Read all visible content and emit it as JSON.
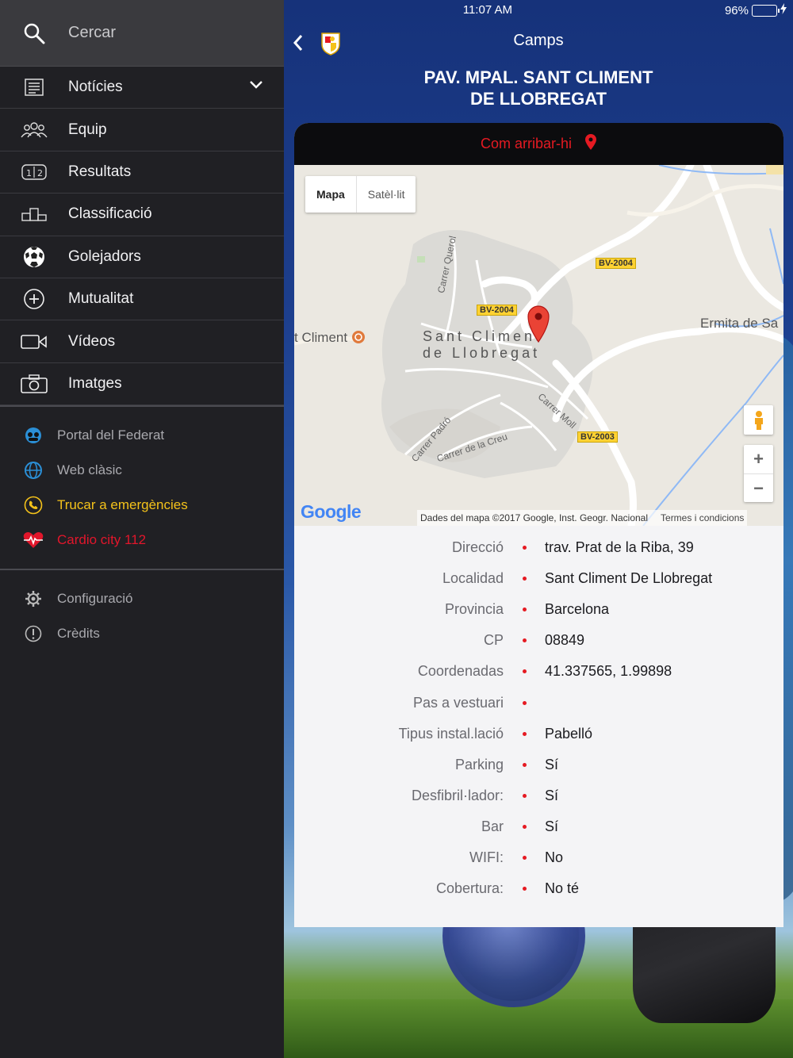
{
  "status": {
    "time": "11:07 AM",
    "battery": "96%"
  },
  "sidebar": {
    "search_label": "Cercar",
    "items": [
      {
        "label": "Notícies",
        "icon": "newspaper-icon"
      },
      {
        "label": "Equip",
        "icon": "team-icon"
      },
      {
        "label": "Resultats",
        "icon": "scoreboard-icon"
      },
      {
        "label": "Classificació",
        "icon": "podium-icon"
      },
      {
        "label": "Golejadors",
        "icon": "soccer-ball-icon"
      },
      {
        "label": "Mutualitat",
        "icon": "plus-circle-icon"
      },
      {
        "label": "Vídeos",
        "icon": "video-camera-icon"
      },
      {
        "label": "Imatges",
        "icon": "camera-icon"
      }
    ],
    "links": [
      {
        "label": "Portal del Federat",
        "icon": "federat-icon"
      },
      {
        "label": "Web clàsic",
        "icon": "globe-icon"
      },
      {
        "label": "Trucar a emergències",
        "icon": "phone-icon"
      },
      {
        "label": "Cardio city 112",
        "icon": "heart-pulse-icon"
      }
    ],
    "settings": [
      {
        "label": "Configuració",
        "icon": "gear-icon"
      },
      {
        "label": "Crèdits",
        "icon": "info-icon"
      }
    ]
  },
  "header": {
    "title": "Camps",
    "venue_line1": "PAV. MPAL. SANT CLIMENT",
    "venue_line2": "DE LLOBREGAT"
  },
  "directions": {
    "label": "Com arribar-hi"
  },
  "map": {
    "toggle": [
      "Mapa",
      "Satèl·lit"
    ],
    "place_line1": "Sant Climent",
    "place_line2": "de Llobregat",
    "poi_left": "t Climent",
    "poi_right": "Ermita de Sa",
    "roads": [
      "BV-2004",
      "BV-2004",
      "BV-2003"
    ],
    "streets": [
      "Carrer Querol",
      "Carrer Moll",
      "Carrer Padró",
      "Carrer de la Creu"
    ],
    "attribution": "Dades del mapa ©2017 Google, Inst. Geogr. Nacional",
    "terms": "Termes i condicions",
    "logo": "Google"
  },
  "info": [
    {
      "label": "Direcció",
      "value": "trav. Prat de la Riba, 39"
    },
    {
      "label": "Localidad",
      "value": "Sant Climent De Llobregat"
    },
    {
      "label": "Provincia",
      "value": "Barcelona"
    },
    {
      "label": "CP",
      "value": "08849"
    },
    {
      "label": "Coordenadas",
      "value": "41.337565, 1.99898"
    },
    {
      "label": "Pas a vestuari",
      "value": ""
    },
    {
      "label": "Tipus instal.lació",
      "value": "Pabelló"
    },
    {
      "label": "Parking",
      "value": "Sí"
    },
    {
      "label": "Desfibril·lador:",
      "value": "Sí"
    },
    {
      "label": "Bar",
      "value": "Sí"
    },
    {
      "label": "WIFI:",
      "value": "No"
    },
    {
      "label": "Cobertura:",
      "value": "No té"
    }
  ],
  "colors": {
    "accent": "#e51a22",
    "warning": "#f4c21a",
    "sidebar_bg": "#202024"
  }
}
